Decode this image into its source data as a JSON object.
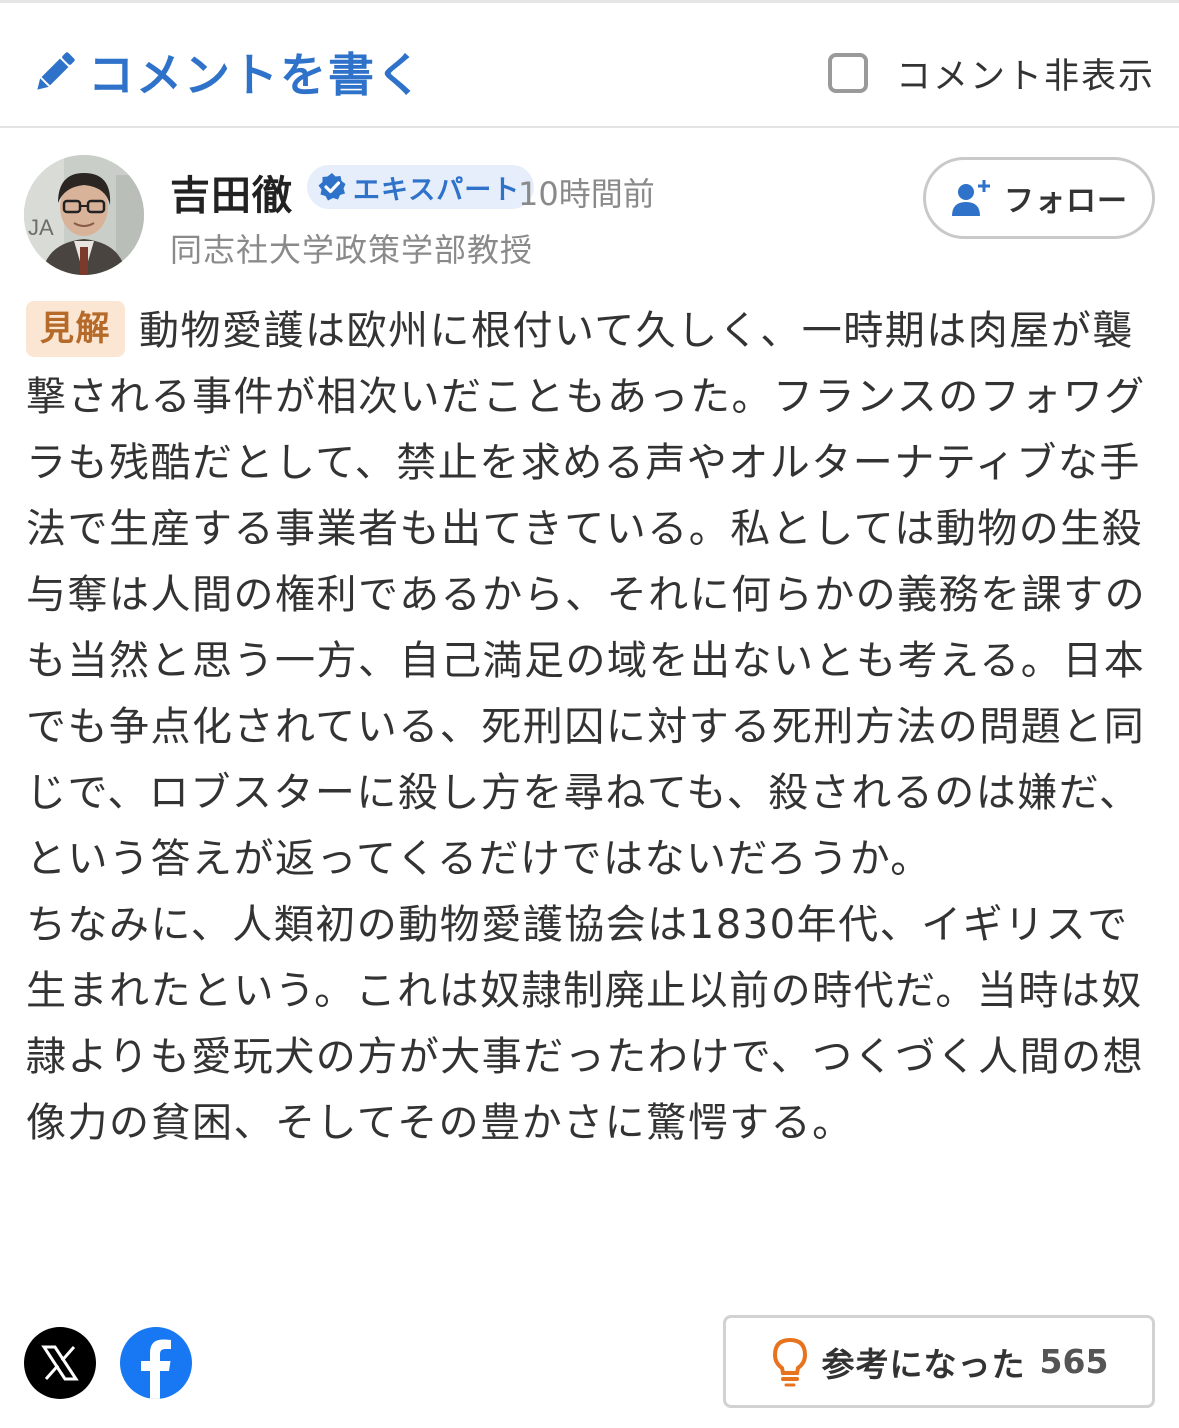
{
  "header": {
    "write_comment_label": "コメントを書く",
    "hide_comments_label": "コメント非表示",
    "hide_comments_checked": false,
    "accent_color": "#2f72c9"
  },
  "author": {
    "name": "吉田徹",
    "badge_label": "エキスパート",
    "posted_ago": "10時間前",
    "title": "同志社大学政策学部教授",
    "follow_label": "フォロー"
  },
  "comment": {
    "tag_label": "見解",
    "paragraphs": [
      "動物愛護は欧州に根付いて久しく、一時期は肉屋が襲撃される事件が相次いだこともあった。フランスのフォワグラも残酷だとして、禁止を求める声やオルターナティブな手法で生産する事業者も出てきている。私としては動物の生殺与奪は人間の権利であるから、それに何らかの義務を課すのも当然と思う一方、自己満足の域を出ないとも考える。日本でも争点化されている、死刑囚に対する死刑方法の問題と同じで、ロブスターに殺し方を尋ねても、殺されるのは嫌だ、という答えが返ってくるだけではないだろうか。",
      "ちなみに、人類初の動物愛護協会は1830年代、イギリスで生まれたという。これは奴隷制廃止以前の時代だ。当時は奴隷よりも愛玩犬の方が大事だったわけで、つくづく人間の想像力の貧困、そしてその豊かさに驚愕する。"
    ]
  },
  "footer": {
    "share_x_icon": "x-logo-icon",
    "share_facebook_icon": "facebook-logo-icon",
    "helpful_label": "参考になった",
    "helpful_count": "565"
  }
}
